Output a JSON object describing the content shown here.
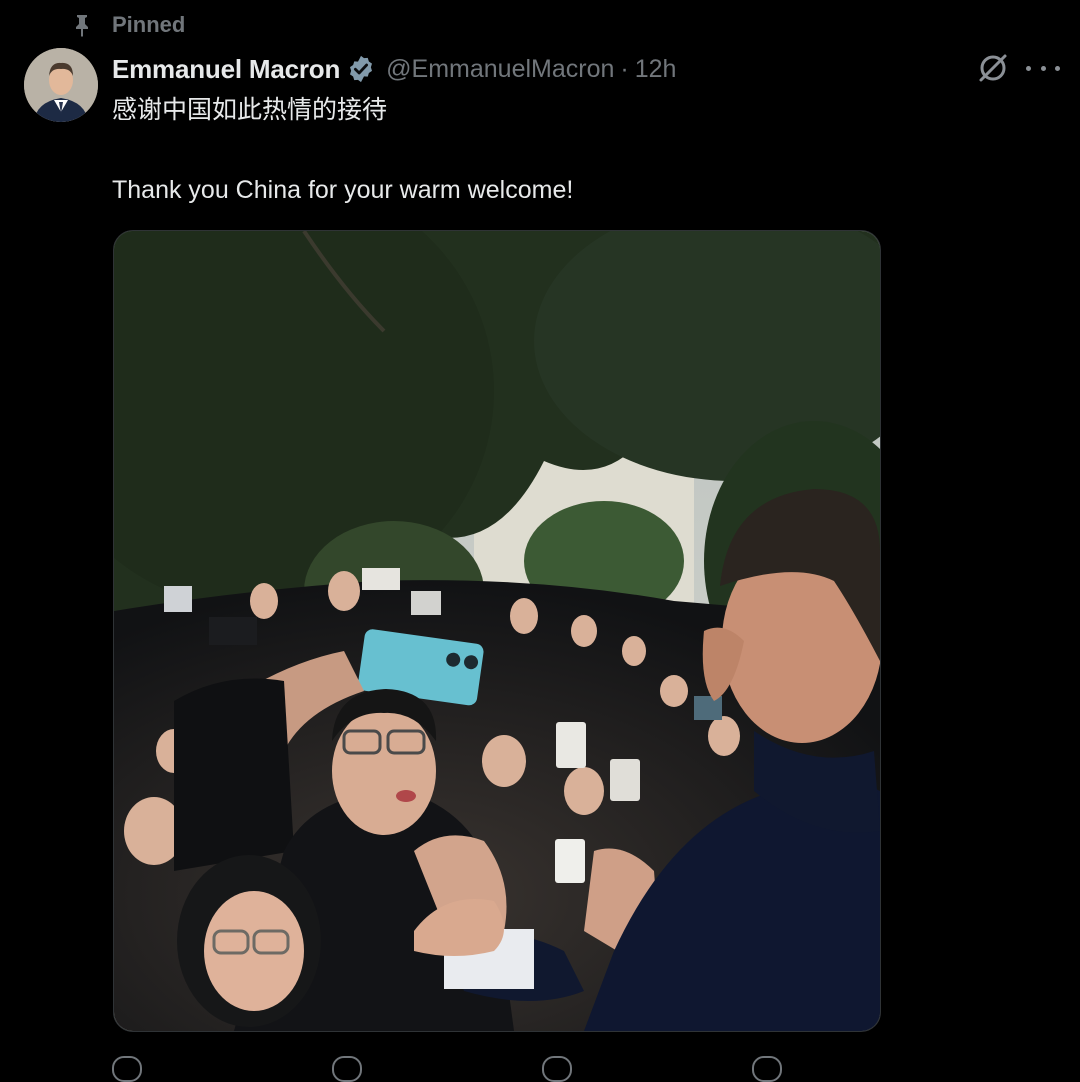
{
  "pinned": {
    "label": "Pinned"
  },
  "author": {
    "display_name": "Emmanuel Macron",
    "handle": "@EmmanuelMacron",
    "separator": "·",
    "time": "12h"
  },
  "tweet": {
    "text_zh": "感谢中国如此热情的接待",
    "text_en": "Thank you China for your warm welcome!"
  },
  "icons": {
    "pin": "pin-icon",
    "verified": "verified-badge-icon",
    "grok": "grok-icon",
    "more": "more-icon"
  },
  "colors": {
    "background": "#000000",
    "text_primary": "#e7e9ea",
    "text_secondary": "#71767b",
    "border": "#2f3336"
  }
}
